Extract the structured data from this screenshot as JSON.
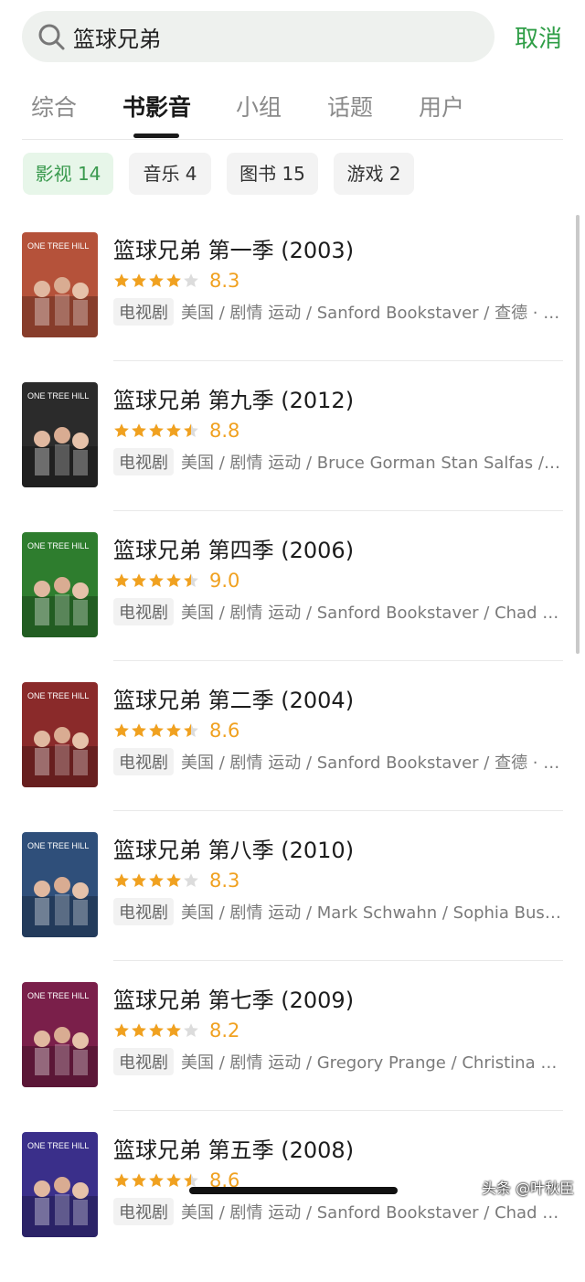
{
  "search": {
    "query": "篮球兄弟",
    "cancel_label": "取消"
  },
  "tabs": [
    {
      "label": "综合",
      "active": false
    },
    {
      "label": "书影音",
      "active": true
    },
    {
      "label": "小组",
      "active": false
    },
    {
      "label": "话题",
      "active": false
    },
    {
      "label": "用户",
      "active": false
    }
  ],
  "filters": [
    {
      "label": "影视 14",
      "active": true
    },
    {
      "label": "音乐 4",
      "active": false
    },
    {
      "label": "图书 15",
      "active": false
    },
    {
      "label": "游戏 2",
      "active": false
    }
  ],
  "results": [
    {
      "title": "篮球兄弟 第一季 (2003)",
      "rating": 4,
      "score": "8.3",
      "tag": "电视剧",
      "meta": "美国 / 剧情 运动 / Sanford Bookstaver / 查德 · …",
      "poster_color": "#b5523a"
    },
    {
      "title": "篮球兄弟 第九季 (2012)",
      "rating": 4.5,
      "score": "8.8",
      "tag": "电视剧",
      "meta": "美国 / 剧情 运动 / Bruce Gorman Stan Salfas /…",
      "poster_color": "#2b2b2b"
    },
    {
      "title": "篮球兄弟 第四季 (2006)",
      "rating": 4.5,
      "score": "9.0",
      "tag": "电视剧",
      "meta": "美国 / 剧情 运动 / Sanford Bookstaver / Chad Mi…",
      "poster_color": "#2e7d2e"
    },
    {
      "title": "篮球兄弟 第二季 (2004)",
      "rating": 4.5,
      "score": "8.6",
      "tag": "电视剧",
      "meta": "美国 / 剧情 运动 / Sanford Bookstaver / 查德 · …",
      "poster_color": "#8a2a2a"
    },
    {
      "title": "篮球兄弟 第八季 (2010)",
      "rating": 4,
      "score": "8.3",
      "tag": "电视剧",
      "meta": "美国 / 剧情 运动 / Mark Schwahn / Sophia Bush…",
      "poster_color": "#2f4f7a"
    },
    {
      "title": "篮球兄弟 第七季 (2009)",
      "rating": 4,
      "score": "8.2",
      "tag": "电视剧",
      "meta": "美国 / 剧情 运动 / Gregory Prange / Christina Bi…",
      "poster_color": "#7a1f4a"
    },
    {
      "title": "篮球兄弟 第五季 (2008)",
      "rating": 4.5,
      "score": "8.6",
      "tag": "电视剧",
      "meta": "美国 / 剧情 运动 / Sanford Bookstaver / Chad Mi…",
      "poster_color": "#3a2f8a"
    }
  ],
  "poster_logo": "ONE TREE HILL",
  "watermark": "头条 @叶秋臣",
  "colors": {
    "accent": "#2f9e47",
    "star": "#f0a120"
  }
}
